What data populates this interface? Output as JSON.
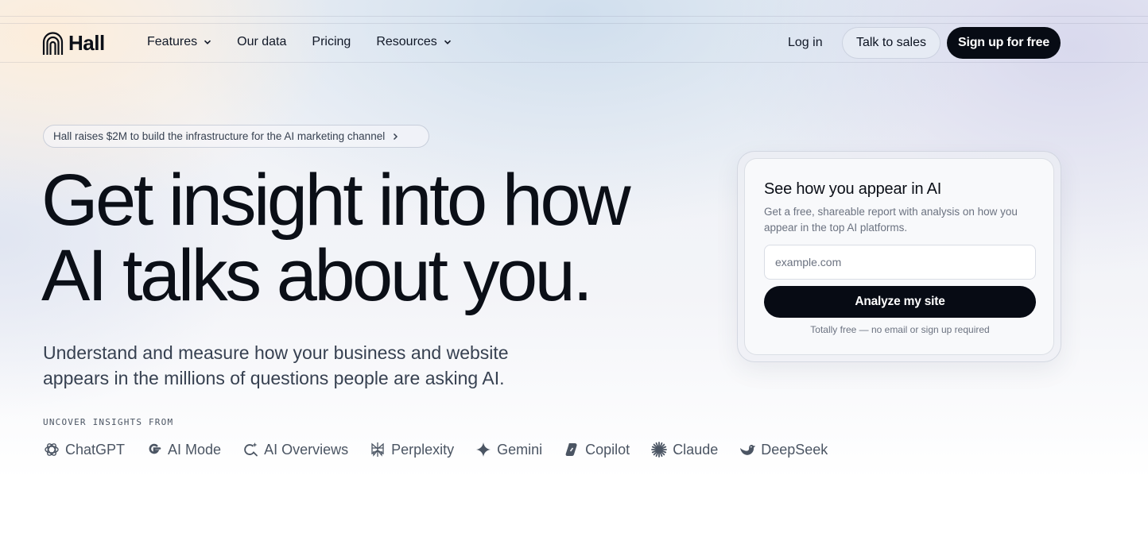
{
  "nav": {
    "logo_text": "Hall",
    "links": [
      {
        "label": "Features",
        "has_dropdown": true
      },
      {
        "label": "Our data",
        "has_dropdown": false
      },
      {
        "label": "Pricing",
        "has_dropdown": false
      },
      {
        "label": "Resources",
        "has_dropdown": true
      }
    ],
    "login_label": "Log in",
    "sales_label": "Talk to sales",
    "signup_label": "Sign up for free"
  },
  "announcement": {
    "text": "Hall raises $2M to build the infrastructure for the AI marketing channel"
  },
  "hero": {
    "title_line1": "Get insight into how",
    "title_line2": "AI talks about you.",
    "subtitle_line1": "Understand and measure how your business and website",
    "subtitle_line2": "appears in the millions of questions people are asking AI.",
    "uncover_label": "UNCOVER INSIGHTS FROM",
    "platforms": [
      {
        "name": "ChatGPT",
        "icon": "chatgpt-icon"
      },
      {
        "name": "AI Mode",
        "icon": "google-icon"
      },
      {
        "name": "AI Overviews",
        "icon": "ai-overviews-icon"
      },
      {
        "name": "Perplexity",
        "icon": "perplexity-icon"
      },
      {
        "name": "Gemini",
        "icon": "gemini-icon"
      },
      {
        "name": "Copilot",
        "icon": "copilot-icon"
      },
      {
        "name": "Claude",
        "icon": "claude-icon"
      },
      {
        "name": "DeepSeek",
        "icon": "deepseek-icon"
      }
    ]
  },
  "card": {
    "title": "See how you appear in AI",
    "description": "Get a free, shareable report with analysis on how you appear in the top AI platforms.",
    "input_placeholder": "example.com",
    "input_value": "",
    "button_label": "Analyze my site",
    "note": "Totally free — no email or sign up required"
  },
  "colors": {
    "primary_dark": "#070b14",
    "text_muted": "#6b7280",
    "secondary_button_bg": "#e8ecf4"
  }
}
